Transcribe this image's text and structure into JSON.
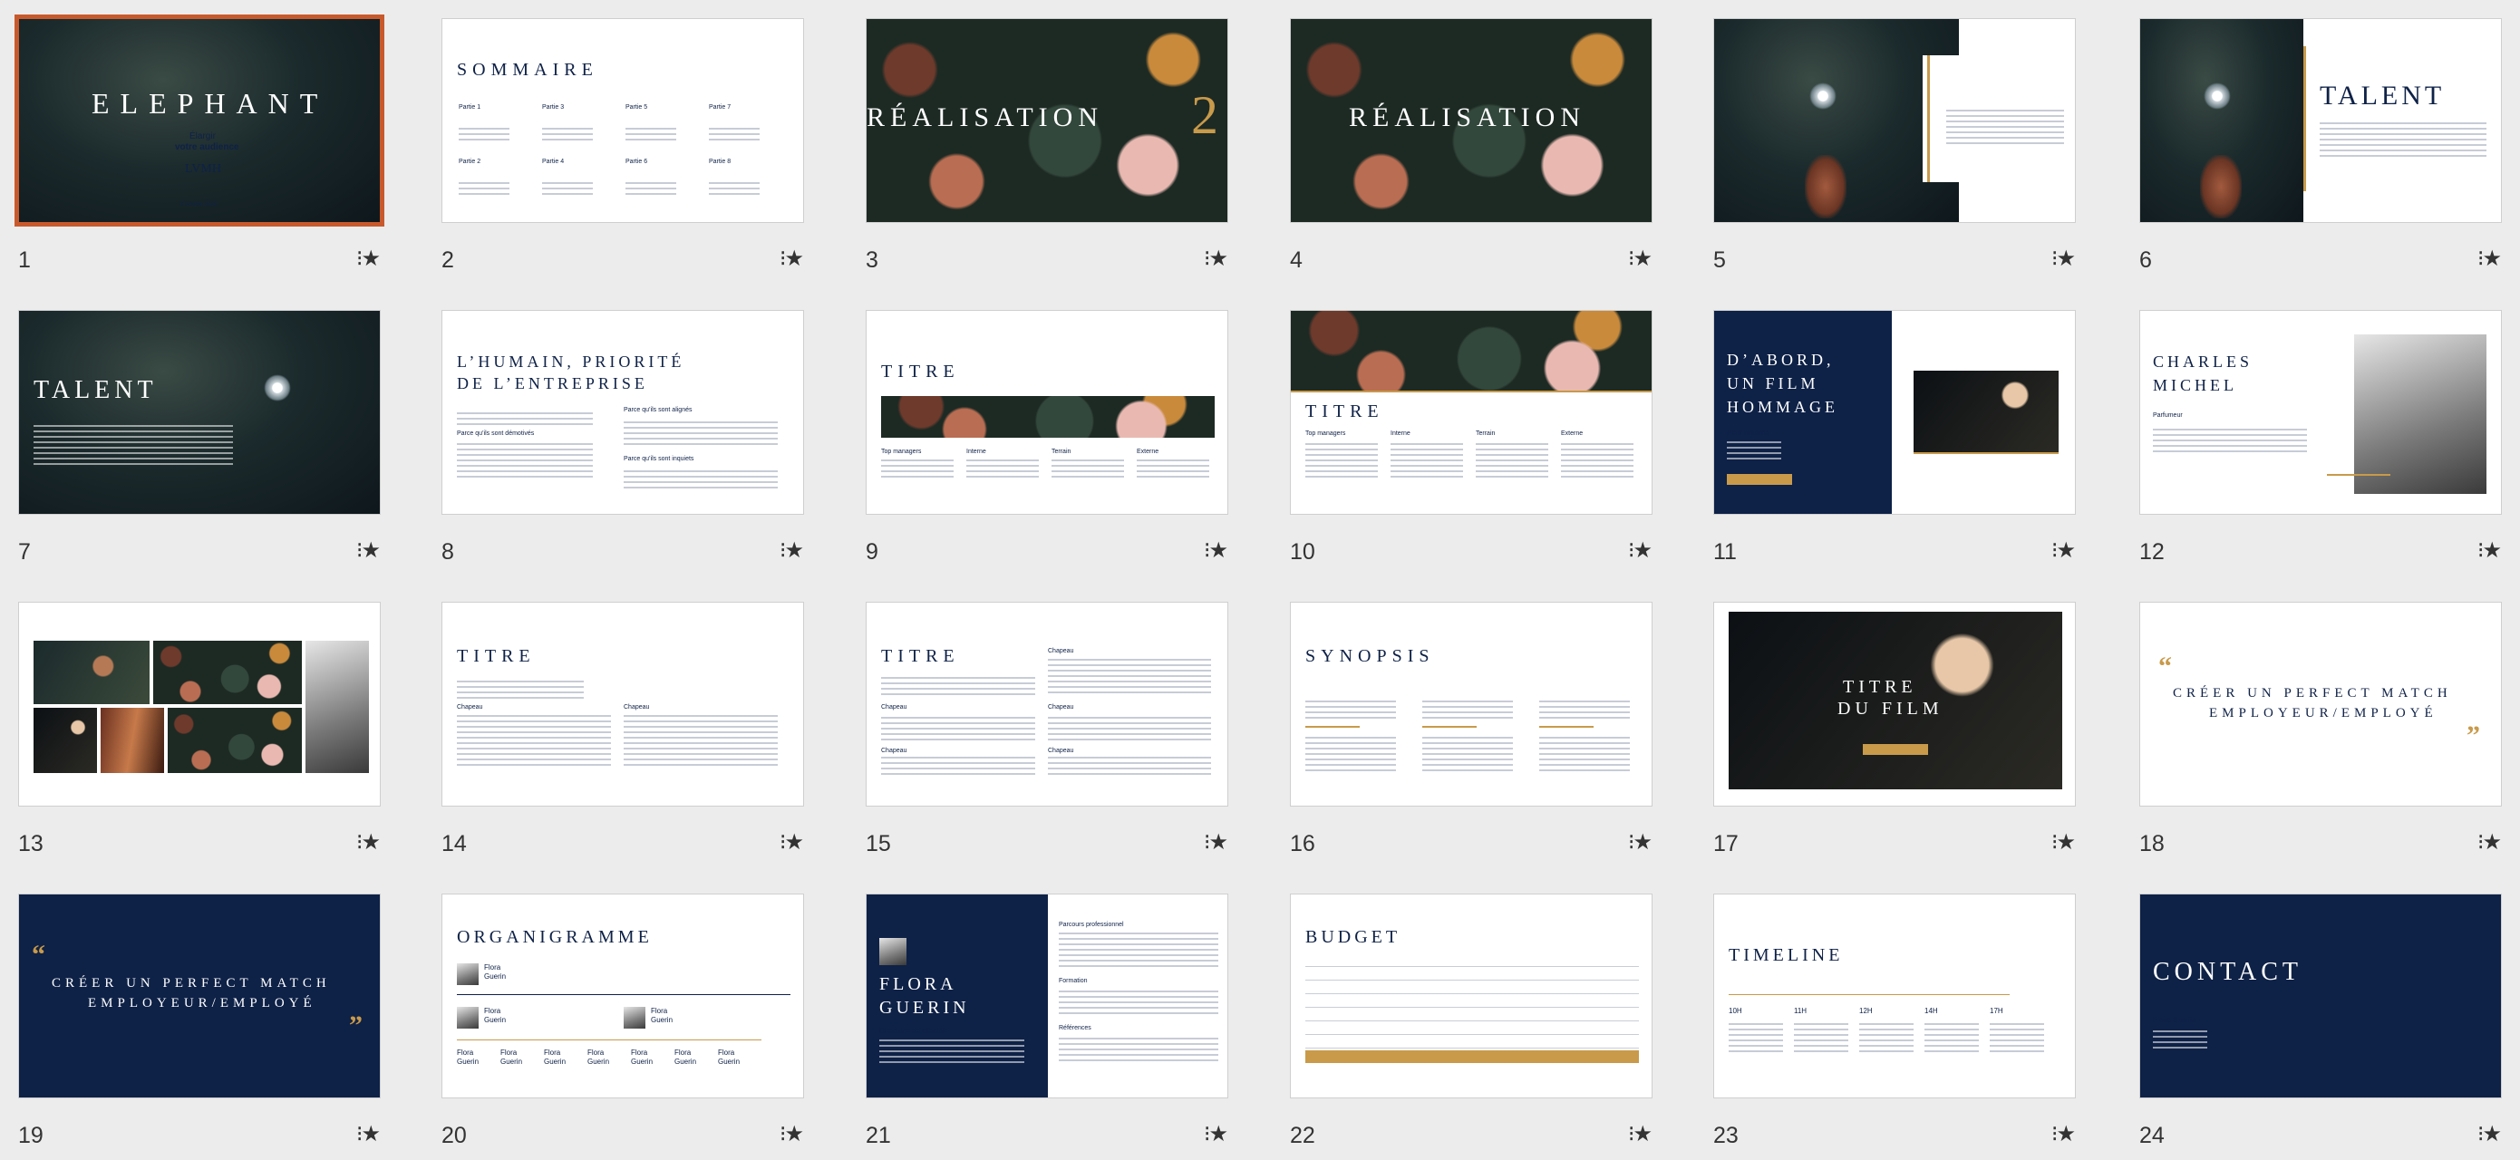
{
  "slides": [
    {
      "n": "1",
      "title": "ELEPHANT",
      "l1": "Élargir",
      "l2": "votre audience",
      "brand": "LVMH",
      "date": "8 octobre 2023"
    },
    {
      "n": "2",
      "title": "SOMMAIRE",
      "parts": [
        "Partie 1",
        "Partie 3",
        "Partie 5",
        "Partie 7",
        "Partie 2",
        "Partie 4",
        "Partie 6",
        "Partie 8"
      ]
    },
    {
      "n": "3",
      "title": "RÉALISATION",
      "deco": "2"
    },
    {
      "n": "4",
      "title": "RÉALISATION"
    },
    {
      "n": "5"
    },
    {
      "n": "6",
      "title": "TALENT"
    },
    {
      "n": "7",
      "title": "TALENT"
    },
    {
      "n": "8",
      "title1": "L’HUMAIN, PRIORITÉ",
      "title2": "DE L’ENTREPRISE",
      "s1": "Parce qu’ils sont alignés",
      "s2": "Parce qu’ils sont démotivés",
      "s3": "Parce qu’ils sont inquiets"
    },
    {
      "n": "9",
      "title": "TITRE",
      "cols": [
        "Top managers",
        "Interne",
        "Terrain",
        "Externe"
      ]
    },
    {
      "n": "10",
      "title": "TITRE",
      "cols": [
        "Top managers",
        "Interne",
        "Terrain",
        "Externe"
      ]
    },
    {
      "n": "11",
      "t1": "D’ABORD,",
      "t2": "UN FILM",
      "t3": "HOMMAGE",
      "sub": "Pour l'interne"
    },
    {
      "n": "12",
      "t1": "CHARLES",
      "t2": "MICHEL",
      "sub": "Parfumeur"
    },
    {
      "n": "13"
    },
    {
      "n": "14",
      "title": "TITRE",
      "c1": "Chapeau",
      "c2": "Chapeau"
    },
    {
      "n": "15",
      "title": "TITRE",
      "c": "Chapeau"
    },
    {
      "n": "16",
      "title": "SYNOPSIS"
    },
    {
      "n": "17",
      "t1": "TITRE",
      "t2": "DU FILM"
    },
    {
      "n": "18",
      "t1": "CRÉER UN PERFECT MATCH",
      "t2": "EMPLOYEUR/EMPLOYÉ"
    },
    {
      "n": "19",
      "t1": "CRÉER UN PERFECT MATCH",
      "t2": "EMPLOYEUR/EMPLOYÉ"
    },
    {
      "n": "20",
      "title": "ORGANIGRAMME",
      "name1": "Flora",
      "name2": "Guerin"
    },
    {
      "n": "21",
      "t1": "FLORA",
      "t2": "GUERIN",
      "sub": "Directrice de clientèle",
      "h1": "Parcours professionnel",
      "h2": "Formation",
      "h3": "Références"
    },
    {
      "n": "22",
      "title": "BUDGET"
    },
    {
      "n": "23",
      "title": "TIMELINE",
      "ticks": [
        "10H",
        "11H",
        "12H",
        "14H",
        "17H"
      ]
    },
    {
      "n": "24",
      "title": "CONTACT",
      "name": "Flora Guerin"
    }
  ]
}
